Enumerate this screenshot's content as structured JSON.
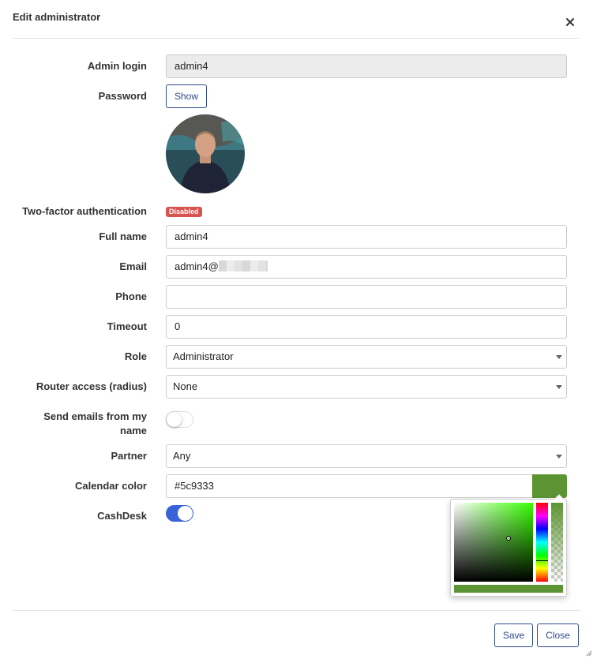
{
  "modal": {
    "title": "Edit administrator"
  },
  "colors": {
    "accent": "#3863d8",
    "brand_blue": "#2c4c8c",
    "danger": "#d9534f",
    "calendar": "#5c9333"
  },
  "icons": {
    "close": "close-icon",
    "caret": "chevron-down-icon",
    "resize": "resize-grip-icon"
  },
  "form": {
    "admin_login": {
      "label": "Admin login",
      "value": "admin4"
    },
    "password": {
      "label": "Password",
      "button": "Show"
    },
    "two_factor": {
      "label": "Two-factor authentication",
      "status": "Disabled"
    },
    "full_name": {
      "label": "Full name",
      "value": "admin4"
    },
    "email": {
      "label": "Email",
      "value": "admin4@"
    },
    "phone": {
      "label": "Phone",
      "value": ""
    },
    "timeout": {
      "label": "Timeout",
      "value": "0"
    },
    "role": {
      "label": "Role",
      "value": "Administrator"
    },
    "router_access": {
      "label": "Router access (radius)",
      "value": "None"
    },
    "send_emails": {
      "label_line1": "Send emails from my",
      "label_line2": "name",
      "enabled": false
    },
    "partner": {
      "label": "Partner",
      "value": "Any"
    },
    "calendar_color": {
      "label": "Calendar color",
      "value": "#5c9333"
    },
    "cashdesk": {
      "label": "CashDesk",
      "enabled": true
    }
  },
  "footer": {
    "save": "Save",
    "close": "Close"
  }
}
